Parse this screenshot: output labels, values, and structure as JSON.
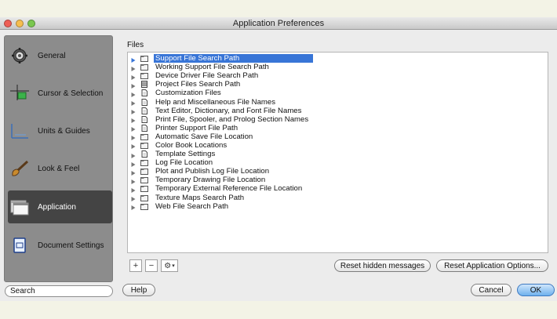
{
  "window": {
    "title": "Application Preferences",
    "colors": {
      "close": "#ee5e55",
      "minimize": "#f6be4f",
      "zoom": "#7ac74f"
    }
  },
  "sidebar": {
    "items": [
      {
        "label": "General",
        "icon": "gear-icon"
      },
      {
        "label": "Cursor & Selection",
        "icon": "cursor-icon"
      },
      {
        "label": "Units & Guides",
        "icon": "ruler-icon"
      },
      {
        "label": "Look & Feel",
        "icon": "paintbrush-icon"
      },
      {
        "label": "Application",
        "icon": "application-icon",
        "selected": true
      },
      {
        "label": "Document Settings",
        "icon": "document-icon"
      }
    ],
    "search_placeholder": "Search"
  },
  "main": {
    "files_label": "Files",
    "tree": [
      {
        "label": "Support File Search Path",
        "icon": "folder-icon",
        "selected": true
      },
      {
        "label": "Working Support File Search Path",
        "icon": "folder-icon"
      },
      {
        "label": "Device Driver File Search Path",
        "icon": "folder-icon"
      },
      {
        "label": "Project Files Search Path",
        "icon": "cabinet-icon"
      },
      {
        "label": "Customization Files",
        "icon": "file-icon"
      },
      {
        "label": "Help and Miscellaneous File Names",
        "icon": "file-icon"
      },
      {
        "label": "Text Editor, Dictionary, and Font File Names",
        "icon": "file-icon"
      },
      {
        "label": "Print File, Spooler, and Prolog Section Names",
        "icon": "file-icon"
      },
      {
        "label": "Printer Support File Path",
        "icon": "file-icon"
      },
      {
        "label": "Automatic Save File Location",
        "icon": "folder-icon"
      },
      {
        "label": "Color Book Locations",
        "icon": "folder-icon"
      },
      {
        "label": "Template Settings",
        "icon": "file-icon"
      },
      {
        "label": "Log File Location",
        "icon": "folder-icon"
      },
      {
        "label": "Plot and Publish Log File Location",
        "icon": "folder-icon"
      },
      {
        "label": "Temporary Drawing File Location",
        "icon": "folder-icon"
      },
      {
        "label": "Temporary External Reference File Location",
        "icon": "folder-icon"
      },
      {
        "label": "Texture Maps Search Path",
        "icon": "folder-icon"
      },
      {
        "label": "Web File Search Path",
        "icon": "folder-icon"
      }
    ],
    "add_label": "+",
    "remove_label": "−",
    "reset_hidden_label": "Reset hidden messages",
    "reset_options_label": "Reset Application Options..."
  },
  "footer": {
    "help_label": "Help",
    "cancel_label": "Cancel",
    "ok_label": "OK"
  }
}
